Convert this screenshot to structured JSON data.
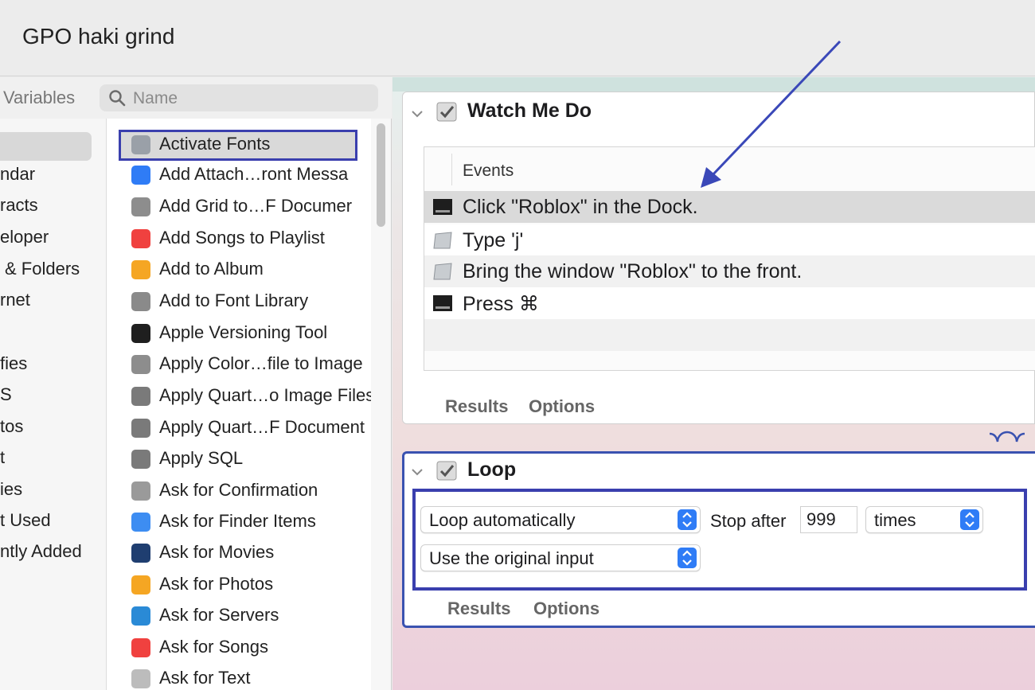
{
  "window": {
    "title": "GPO haki grind"
  },
  "library": {
    "variables_tab": "Variables",
    "search_placeholder": "Name",
    "categories": [
      "ndar",
      "racts",
      "eloper",
      "& Folders",
      "rnet",
      "",
      "fies",
      "S",
      "tos",
      "t",
      "ies",
      "t Used",
      "ntly Added"
    ],
    "actions": [
      {
        "label": "Activate Fonts",
        "icon": "font-book-icon",
        "color": "#9aa0a8"
      },
      {
        "label": "Add Attach…ront Messa",
        "icon": "mail-attachment-icon",
        "color": "#2f7cf6"
      },
      {
        "label": "Add Grid to…F Documer",
        "icon": "pdf-grid-icon",
        "color": "#8d8d8d"
      },
      {
        "label": "Add Songs to Playlist",
        "icon": "music-icon",
        "color": "#f0413f"
      },
      {
        "label": "Add to Album",
        "icon": "photos-icon",
        "color": "#f5a623"
      },
      {
        "label": "Add to Font Library",
        "icon": "font-library-icon",
        "color": "#8a8a8a"
      },
      {
        "label": "Apple Versioning Tool",
        "icon": "terminal-icon",
        "color": "#1f1f1f"
      },
      {
        "label": "Apply Color…file to Image",
        "icon": "color-profile-icon",
        "color": "#8d8d8d"
      },
      {
        "label": "Apply Quart…o Image Files",
        "icon": "quartz-filter-icon",
        "color": "#7a7a7a"
      },
      {
        "label": "Apply Quart…F Document",
        "icon": "quartz-filter-icon",
        "color": "#7a7a7a"
      },
      {
        "label": "Apply SQL",
        "icon": "sql-icon",
        "color": "#7a7a7a"
      },
      {
        "label": "Ask for Confirmation",
        "icon": "automator-icon",
        "color": "#9a9a9a"
      },
      {
        "label": "Ask for Finder Items",
        "icon": "finder-icon",
        "color": "#3d8df2"
      },
      {
        "label": "Ask for Movies",
        "icon": "quicktime-icon",
        "color": "#1f3e70"
      },
      {
        "label": "Ask for Photos",
        "icon": "photos-icon",
        "color": "#f5a623"
      },
      {
        "label": "Ask for Servers",
        "icon": "safari-icon",
        "color": "#2a8ad6"
      },
      {
        "label": "Ask for Songs",
        "icon": "music-icon",
        "color": "#f0413f"
      },
      {
        "label": "Ask for Text",
        "icon": "text-edit-icon",
        "color": "#bcbcbc"
      }
    ]
  },
  "watch_me_do": {
    "title": "Watch Me Do",
    "events_header": "Events",
    "events": [
      {
        "text": "Click \"Roblox\" in the Dock.",
        "icon": "dock-icon"
      },
      {
        "text": "Type 'j'",
        "icon": "keyboard-icon"
      },
      {
        "text": "Bring the window \"Roblox\" to the front.",
        "icon": "keyboard-icon"
      },
      {
        "text": "Press ⌘",
        "icon": "dock-icon"
      }
    ],
    "tabs": [
      "Results",
      "Options"
    ]
  },
  "loop": {
    "title": "Loop",
    "mode": "Loop automatically",
    "stop_after_label": "Stop after",
    "stop_after_value": "999",
    "unit": "times",
    "input_mode": "Use the original input",
    "tabs": [
      "Results",
      "Options"
    ]
  },
  "colors": {
    "highlight": "#3a3fae",
    "accent": "#2f7cf6"
  }
}
